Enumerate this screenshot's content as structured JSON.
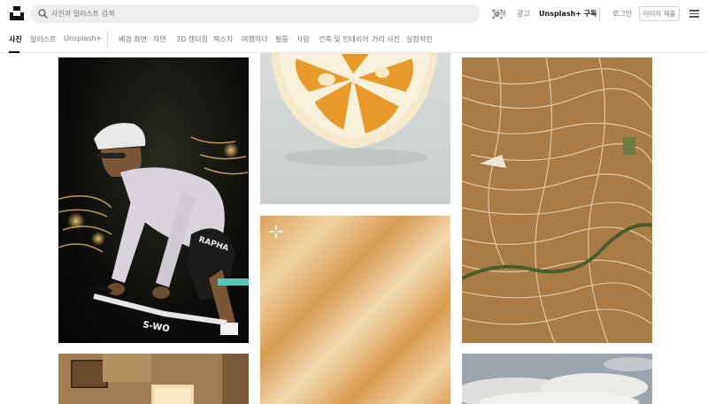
{
  "search": {
    "placeholder": "사진과 일러스트 검색"
  },
  "nav": {
    "explore": "탐색",
    "advertise": "광고",
    "plus": "Unsplash+ 구독",
    "login": "로그인",
    "submit": "이미지 제출"
  },
  "tabs": [
    {
      "label": "사진",
      "active": true
    },
    {
      "label": "일러스트"
    },
    {
      "label": "Unsplash+"
    },
    {
      "label": "배경 화면"
    },
    {
      "label": "자연"
    },
    {
      "label": "3D 렌더링"
    },
    {
      "label": "텍스처"
    },
    {
      "label": "여행하다"
    },
    {
      "label": "필름"
    },
    {
      "label": "사람"
    },
    {
      "label": "건축 및 인테리어"
    },
    {
      "label": "거리 사진"
    },
    {
      "label": "실험적인"
    }
  ],
  "photos": [
    {
      "subject": "cyclist",
      "icon": "photo"
    },
    {
      "subject": "lemon-slice",
      "icon": "photo"
    },
    {
      "subject": "sand-texture",
      "icon": "unsplash-plus-icon"
    },
    {
      "subject": "rice-terraces-aerial",
      "icon": "photo"
    },
    {
      "subject": "lamp-room",
      "icon": "photo"
    },
    {
      "subject": "clouds-aerial",
      "icon": "photo"
    }
  ],
  "colors": {
    "text_primary": "#111111",
    "text_secondary": "#767676",
    "search_bg": "#eeeeee",
    "border": "#d1d1d1"
  }
}
